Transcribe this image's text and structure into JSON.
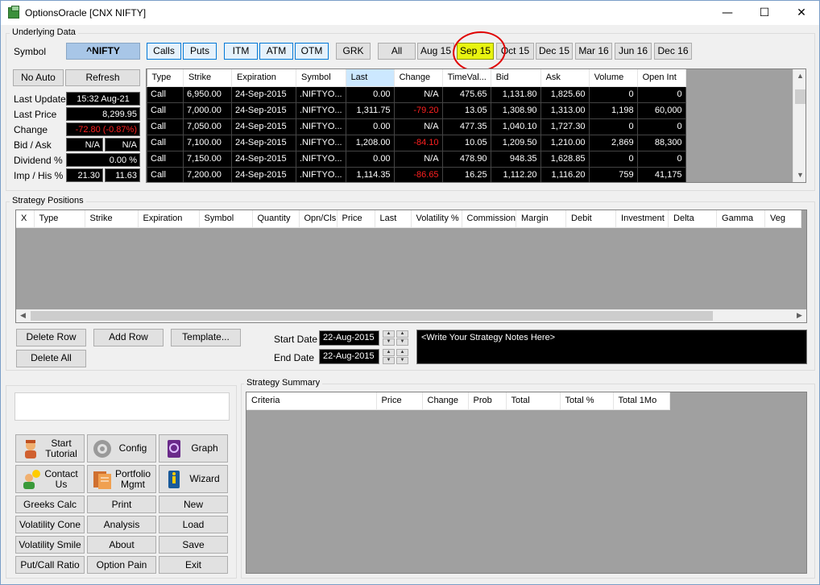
{
  "window": {
    "title": "OptionsOracle [CNX NIFTY]",
    "minimize": "—",
    "maximize": "☐",
    "close": "✕"
  },
  "underlying": {
    "group_label": "Underlying Data",
    "symbol_label": "Symbol",
    "symbol_value": "^NIFTY",
    "no_auto": "No Auto",
    "refresh": "Refresh",
    "last_update_label": "Last Update",
    "last_update": "15:32 Aug-21",
    "last_price_label": "Last Price",
    "last_price": "8,299.95",
    "change_label": "Change",
    "change": "-72.80 (-0.87%)",
    "bid_ask_label": "Bid / Ask",
    "bid": "N/A",
    "ask": "N/A",
    "dividend_label": "Dividend %",
    "dividend": "0.00 %",
    "imp_his_label": "Imp / His %",
    "imp": "21.30",
    "his": "11.63"
  },
  "filters": {
    "calls": "Calls",
    "puts": "Puts",
    "itm": "ITM",
    "atm": "ATM",
    "otm": "OTM",
    "grk": "GRK",
    "all": "All",
    "expiries": [
      "Aug 15",
      "Sep 15",
      "Oct 15",
      "Dec 15",
      "Mar 16",
      "Jun 16",
      "Dec 16"
    ],
    "selected_expiry": "Sep 15"
  },
  "option_chain": {
    "columns": [
      "Type",
      "Strike",
      "Expiration",
      "Symbol",
      "Last",
      "Change",
      "TimeVal...",
      "Bid",
      "Ask",
      "Volume",
      "Open Int"
    ],
    "rows": [
      [
        "Call",
        "6,950.00",
        "24-Sep-2015",
        ".NIFTYO...",
        "0.00",
        "N/A",
        "475.65",
        "1,131.80",
        "1,825.60",
        "0",
        "0"
      ],
      [
        "Call",
        "7,000.00",
        "24-Sep-2015",
        ".NIFTYO...",
        "1,311.75",
        "-79.20",
        "13.05",
        "1,308.90",
        "1,313.00",
        "1,198",
        "60,000"
      ],
      [
        "Call",
        "7,050.00",
        "24-Sep-2015",
        ".NIFTYO...",
        "0.00",
        "N/A",
        "477.35",
        "1,040.10",
        "1,727.30",
        "0",
        "0"
      ],
      [
        "Call",
        "7,100.00",
        "24-Sep-2015",
        ".NIFTYO...",
        "1,208.00",
        "-84.10",
        "10.05",
        "1,209.50",
        "1,210.00",
        "2,869",
        "88,300"
      ],
      [
        "Call",
        "7,150.00",
        "24-Sep-2015",
        ".NIFTYO...",
        "0.00",
        "N/A",
        "478.90",
        "948.35",
        "1,628.85",
        "0",
        "0"
      ],
      [
        "Call",
        "7,200.00",
        "24-Sep-2015",
        ".NIFTYO...",
        "1,114.35",
        "-86.65",
        "16.25",
        "1,112.20",
        "1,116.20",
        "759",
        "41,175"
      ]
    ]
  },
  "strategy": {
    "group_label": "Strategy Positions",
    "columns": [
      "X",
      "Type",
      "Strike",
      "Expiration",
      "Symbol",
      "Quantity",
      "Opn/Cls",
      "Price",
      "Last",
      "Volatility %",
      "Commission",
      "Margin",
      "Debit",
      "Investment",
      "Delta",
      "Gamma",
      "Veg"
    ],
    "delete_row": "Delete Row",
    "add_row": "Add Row",
    "template": "Template...",
    "delete_all": "Delete All",
    "start_date_label": "Start Date",
    "start_date": "22-Aug-2015",
    "end_date_label": "End Date",
    "end_date": "22-Aug-2015",
    "notes": "<Write Your Strategy Notes Here>"
  },
  "summary": {
    "group_label": "Strategy Summary",
    "columns": [
      "Criteria",
      "Price",
      "Change",
      "Prob",
      "Total",
      "Total %",
      "Total 1Mo"
    ]
  },
  "tools": {
    "start_tutorial": "Start Tutorial",
    "config": "Config",
    "graph": "Graph",
    "contact_us": "Contact Us",
    "portfolio_mgmt": "Portfolio Mgmt",
    "wizard": "Wizard",
    "greeks_calc": "Greeks Calc",
    "print": "Print",
    "new": "New",
    "volatility_cone": "Volatility Cone",
    "analysis": "Analysis",
    "load": "Load",
    "volatility_smile": "Volatility Smile",
    "about": "About",
    "save": "Save",
    "put_call_ratio": "Put/Call Ratio",
    "option_pain": "Option Pain",
    "exit": "Exit"
  }
}
